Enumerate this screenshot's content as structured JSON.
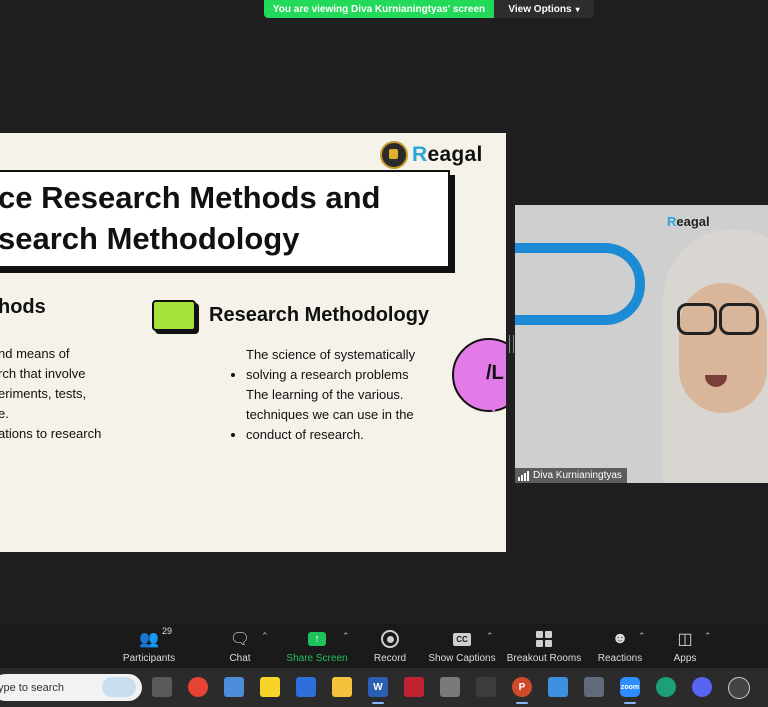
{
  "banner": {
    "message": "You are viewing Diva Kurnianingtyas' screen",
    "options_label": "View Options",
    "accent_color": "#23d959"
  },
  "slide": {
    "logo_text": "Reagal",
    "title_line1": "ce Research Methods and",
    "title_line2": "search Methodology",
    "left_heading": "hods",
    "left_lines": [
      "nd means of",
      "rch that involve",
      "eriments, tests,",
      "e.",
      "ations to research"
    ],
    "right_heading": "Research Methodology",
    "right_bullets": [
      "The science of systematically solving a research problems",
      "The learning of the various. techniques we can use in the conduct of research."
    ],
    "bubble_glyph": "/L",
    "colors": {
      "green_square": "#a6e33a",
      "bubble": "#e27ae8",
      "background": "#f5f2e9"
    }
  },
  "video": {
    "participant_name": "Diva Kurnianingtyas",
    "logo_text": "Reagal"
  },
  "toolbar": {
    "participants_count": "29",
    "items": [
      {
        "label": "Participants",
        "icon": "participants-icon"
      },
      {
        "label": "Chat",
        "icon": "chat-icon"
      },
      {
        "label": "Share Screen",
        "icon": "share-screen-icon"
      },
      {
        "label": "Record",
        "icon": "record-icon"
      },
      {
        "label": "Show Captions",
        "icon": "cc-icon"
      },
      {
        "label": "Breakout Rooms",
        "icon": "breakout-rooms-icon"
      },
      {
        "label": "Reactions",
        "icon": "reactions-icon"
      },
      {
        "label": "Apps",
        "icon": "apps-icon"
      }
    ],
    "share_color": "#1fc15a"
  },
  "taskbar": {
    "search_placeholder": "ype to search",
    "icons": [
      "task-view-icon",
      "chrome-icon",
      "photos-icon",
      "sticky-notes-icon",
      "todo-icon",
      "file-explorer-icon",
      "word-icon",
      "app-red-icon",
      "snipping-tool-icon",
      "sync-icon",
      "powerpoint-icon",
      "paint-icon",
      "calculator-icon",
      "zoom-icon",
      "edge-icon",
      "discord-icon",
      "obs-icon"
    ],
    "zoom_label": "zoom"
  }
}
